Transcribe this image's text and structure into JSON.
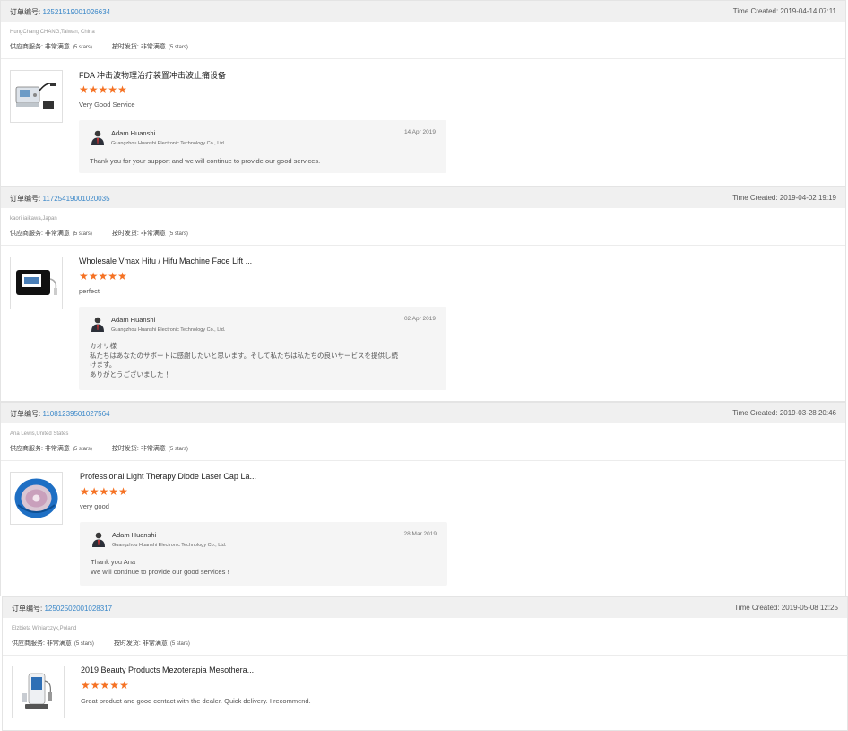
{
  "labels": {
    "order_label": "订单编号:",
    "time_label": "Time Created:",
    "supplier_service": "供应商服务:",
    "on_time": "按时发货:"
  },
  "orders": [
    {
      "order_no": "12521519001026634",
      "time": "2019-04-14 07:11",
      "buyer": "HungChang CHANG,Taiwan, China",
      "service_rating": "非常满意",
      "service_stars": "(5 stars)",
      "shipping_rating": "非常满意",
      "shipping_stars": "(5 stars)",
      "product_title": "FDA 冲击波物理治疗装置冲击波止痛设备",
      "rating": 5,
      "feedback": "Very Good Service",
      "reply": {
        "name": "Adam Huanshi",
        "company": "Guangzhou Huanshi Electronic Technology Co., Ltd.",
        "date": "14 Apr 2019",
        "text": "Thank  you for your support and we will continue to provide our good services."
      }
    },
    {
      "order_no": "11725419001020035",
      "time": "2019-04-02 19:19",
      "buyer": "kaori iaikawa,Japan",
      "service_rating": "非常满意",
      "service_stars": "(5 stars)",
      "shipping_rating": "非常满意",
      "shipping_stars": "(5 stars)",
      "product_title": "Wholesale Vmax Hifu / Hifu Machine Face Lift ...",
      "rating": 5,
      "feedback": "perfect",
      "reply": {
        "name": "Adam Huanshi",
        "company": "Guangzhou Huanshi Electronic Technology Co., Ltd.",
        "date": "02 Apr 2019",
        "text": "カオリ様\n私たちはあなたのサポートに感謝したいと思います。そして私たちは私たちの良いサービスを提供し続\nけます。\nありがとうございました ！"
      }
    },
    {
      "order_no": "11081239501027564",
      "time": "2019-03-28 20:46",
      "buyer": "Ana Lewis,United States",
      "service_rating": "非常满意",
      "service_stars": "(5 stars)",
      "shipping_rating": "非常满意",
      "shipping_stars": "(5 stars)",
      "product_title": "Professional Light Therapy Diode Laser Cap La...",
      "rating": 5,
      "feedback": "very good",
      "reply": {
        "name": "Adam Huanshi",
        "company": "Guangzhou Huanshi Electronic Technology Co., Ltd.",
        "date": "28 Mar 2019",
        "text": "Thank you Ana\nWe will continue to provide our good services !"
      }
    },
    {
      "order_no": "12502502001028317",
      "time": "2019-05-08 12:25",
      "buyer": "Elzbieta Winiarczyk,Poland",
      "service_rating": "非常满意",
      "service_stars": "(5 stars)",
      "shipping_rating": "非常满意",
      "shipping_stars": "(5 stars)",
      "product_title": "2019 Beauty Products Mezoterapia Mesothera...",
      "rating": 5,
      "feedback": "Great product and good contact with the dealer. Quick delivery. I recommend."
    }
  ]
}
